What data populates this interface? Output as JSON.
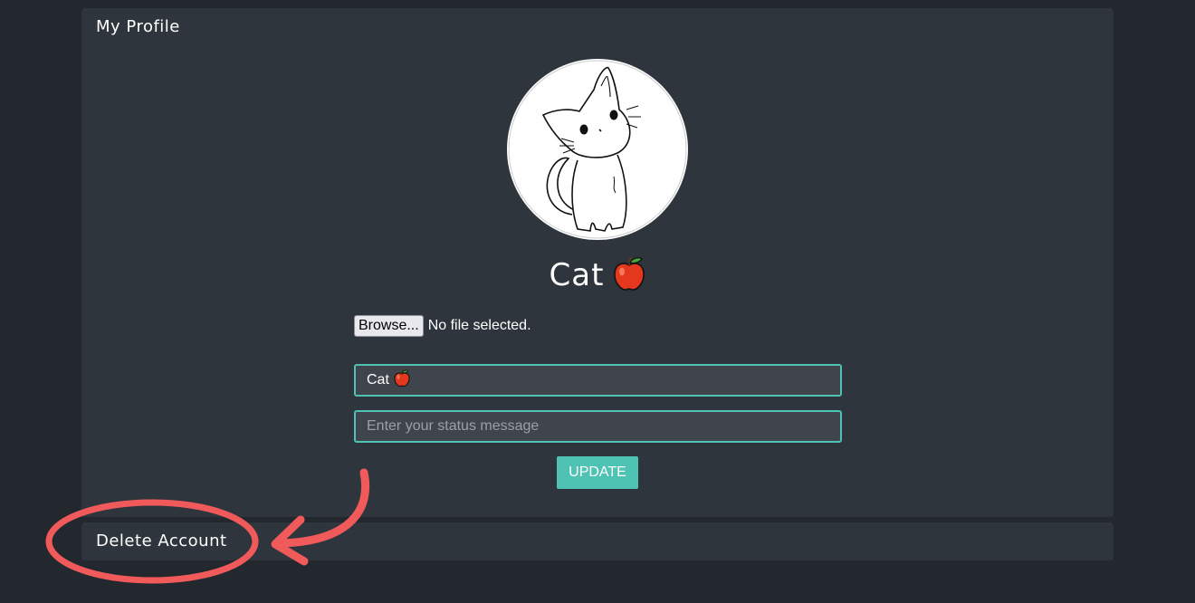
{
  "profile": {
    "title": "My Profile",
    "display_name": "Cat",
    "name_emoji": "apple-icon",
    "file_input": {
      "button_label": "Browse...",
      "status": "No file selected."
    },
    "name_field": {
      "value": "Cat"
    },
    "status_field": {
      "placeholder": "Enter your status message",
      "value": ""
    },
    "update_button": "UPDATE"
  },
  "delete_account": {
    "label": "Delete Account"
  },
  "annotation": {
    "color": "#f05a5a",
    "type": "red-circle-and-arrow"
  },
  "colors": {
    "background": "#23282f",
    "panel": "#2f353d",
    "accent": "#4ec2b3",
    "input_bg": "#40454d"
  }
}
